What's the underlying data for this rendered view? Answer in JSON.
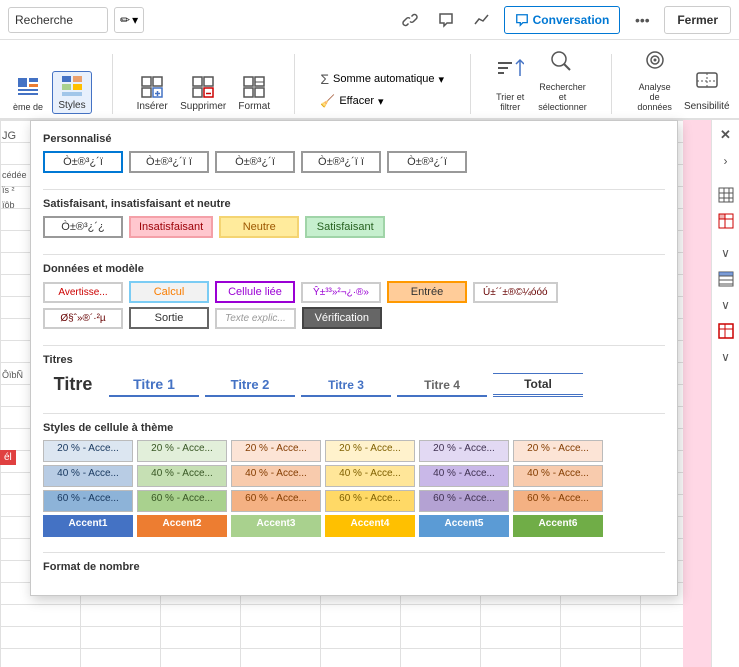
{
  "toolbar": {
    "search_label": "Recherche",
    "edit_icon": "✏",
    "chevron_down": "▾",
    "link_icon": "🔗",
    "chat_icon": "💬",
    "chart_icon": "📈",
    "conversation_label": "Conversation",
    "more_icon": "•••",
    "fermer_label": "Fermer"
  },
  "ribbon": {
    "theme_label": "ème de",
    "styles_label": "Styles",
    "inserer_label": "Insérer",
    "supprimer_label": "Supprimer",
    "format_label": "Format",
    "somme_auto_label": "Somme automatique",
    "effacer_label": "Effacer",
    "trier_label": "Trier et\nfiltrer",
    "rechercher_label": "Rechercher et\nsélectionner",
    "analyse_label": "Analyse de\ndonnées",
    "sensibilite_label": "Sensibilité"
  },
  "dropdown": {
    "personnalise_title": "Personnalisé",
    "personnalise_styles": [
      {
        "label": "Ò±®³¿´ï",
        "selected": true
      },
      {
        "label": "Ò±®³¿´ï ï"
      },
      {
        "label": "Ò±®³¿´ï"
      },
      {
        "label": "Ò±®³¿´ï ï"
      },
      {
        "label": "Ò±®³¿´ï"
      }
    ],
    "satisfaisant_title": "Satisfaisant, insatisfaisant et neutre",
    "satisfaisant_base": "Ò±®³¿´",
    "insatisfaisant_label": "Insatisfaisant",
    "neutre_label": "Neutre",
    "satisfaisant_label": "Satisfaisant",
    "donnees_title": "Données et modèle",
    "avertissement_label": "Avertisse...",
    "calcul_label": "Calcul",
    "cellule_liee_label": "Cellule liée",
    "entree_complexe_label": "Ŷ±³³»²¬¿·®»",
    "entree_label": "Entrée",
    "donnees_label": "Ø§ˆ»®´·²µ",
    "sortie_label": "Sortie",
    "texte_expl_label": "Texte explic...",
    "verification_label": "Vérification",
    "texte2_label": "Ú±´´±®©¼óóó",
    "titres_title": "Titres",
    "titre_label": "Titre",
    "titre1_label": "Titre 1",
    "titre2_label": "Titre 2",
    "titre3_label": "Titre 3",
    "titre4_label": "Titre 4",
    "total_label": "Total",
    "theme_title": "Styles de cellule à thème",
    "accent_rows": [
      {
        "pct": "20 %",
        "cells": [
          "20 % - Acce...",
          "20 % - Acce...",
          "20 % - Acce...",
          "20 % - Acce...",
          "20 % - Acce...",
          "20 % - Acce..."
        ],
        "colors": [
          "#dce6f1",
          "#e2efda",
          "#fce4d6",
          "#fff2cc",
          "#e2d9f3",
          "#fce4d6"
        ],
        "text_colors": [
          "#17375e",
          "#375623",
          "#833c00",
          "#7f6000",
          "#3f3151",
          "#833c00"
        ]
      },
      {
        "pct": "40 %",
        "cells": [
          "40 % - Acce...",
          "40 % - Acce...",
          "40 % - Acce...",
          "40 % - Acce...",
          "40 % - Acce...",
          "40 % - Acce..."
        ],
        "colors": [
          "#b8cce4",
          "#c6e0b4",
          "#f8cbad",
          "#ffe699",
          "#c9b8e8",
          "#f8cbad"
        ],
        "text_colors": [
          "#17375e",
          "#375623",
          "#833c00",
          "#7f6000",
          "#3f3151",
          "#833c00"
        ]
      },
      {
        "pct": "60 %",
        "cells": [
          "60 % - Acce...",
          "60 % - Acce...",
          "60 % - Acce...",
          "60 % - Acce...",
          "60 % - Acce...",
          "60 % - Acce..."
        ],
        "colors": [
          "#8db3d8",
          "#a9d18e",
          "#f4b183",
          "#ffd966",
          "#b4a2d3",
          "#f4b183"
        ],
        "text_colors": [
          "#17375e",
          "#375623",
          "#833c00",
          "#7f6000",
          "#3f3151",
          "#833c00"
        ]
      },
      {
        "pct": "accent",
        "cells": [
          "Accent1",
          "Accent2",
          "Accent3",
          "Accent4",
          "Accent5",
          "Accent6"
        ],
        "colors": [
          "#4472c4",
          "#ed7d31",
          "#a9d18e",
          "#ffc000",
          "#5b9bd5",
          "#70ad47"
        ],
        "text_colors": [
          "#fff",
          "#fff",
          "#fff",
          "#fff",
          "#fff",
          "#fff"
        ]
      }
    ],
    "format_nombre_title": "Format de nombre"
  }
}
